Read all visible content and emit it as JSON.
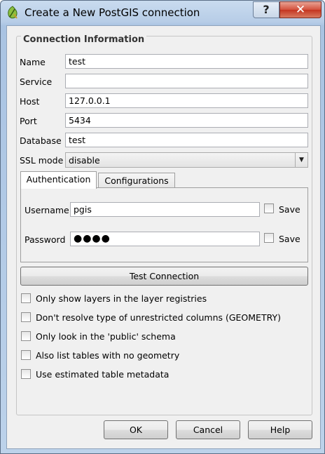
{
  "window": {
    "title": "Create a New PostGIS connection",
    "help_glyph": "?",
    "close_glyph": "✕"
  },
  "group": {
    "title": "Connection Information"
  },
  "fields": {
    "name": {
      "label": "Name",
      "value": "test"
    },
    "service": {
      "label": "Service",
      "value": ""
    },
    "host": {
      "label": "Host",
      "value": "127.0.0.1"
    },
    "port": {
      "label": "Port",
      "value": "5434"
    },
    "database": {
      "label": "Database",
      "value": "test"
    },
    "ssl": {
      "label": "SSL mode",
      "value": "disable"
    }
  },
  "tabs": {
    "authentication": "Authentication",
    "configurations": "Configurations"
  },
  "auth": {
    "username": {
      "label": "Username",
      "value": "pgis",
      "save_label": "Save"
    },
    "password": {
      "label": "Password",
      "value": "●●●●",
      "save_label": "Save"
    }
  },
  "test_connection": "Test Connection",
  "options": [
    "Only show layers in the layer registries",
    "Don't resolve type of unrestricted columns (GEOMETRY)",
    "Only look in the 'public' schema",
    "Also list tables with no geometry",
    "Use estimated table metadata"
  ],
  "buttons": {
    "ok": "OK",
    "cancel": "Cancel",
    "help": "Help"
  },
  "icons": {
    "app": "qgis-icon",
    "dropdown": "chevron-down-icon"
  }
}
